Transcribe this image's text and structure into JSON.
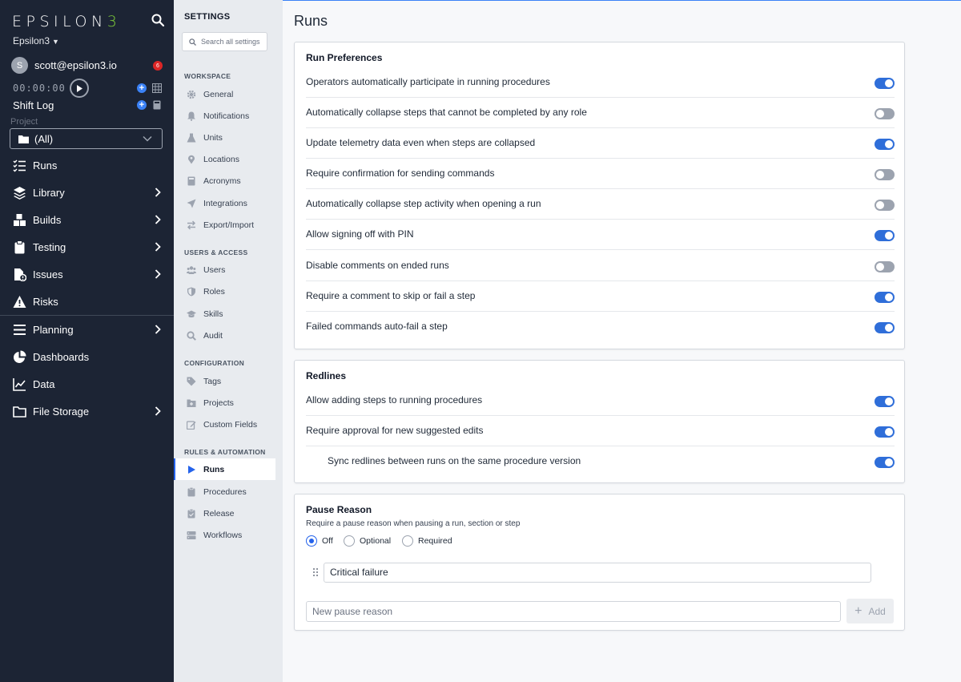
{
  "nav": {
    "logo_main": "EPSILON",
    "logo_accent": "3",
    "workspace": "Epsilon3",
    "user_initial": "S",
    "user_email": "scott@epsilon3.io",
    "notification_count": "6",
    "timer": "00:00:00",
    "shift_log": "Shift Log",
    "project_label": "Project",
    "project_value": "(All)",
    "items": [
      {
        "label": "Runs",
        "icon": "list-check-icon"
      },
      {
        "label": "Library",
        "icon": "layers-icon"
      },
      {
        "label": "Builds",
        "icon": "cubes-icon"
      },
      {
        "label": "Testing",
        "icon": "clipboard-icon"
      },
      {
        "label": "Issues",
        "icon": "file-alert-icon"
      },
      {
        "label": "Risks",
        "icon": "warning-icon"
      },
      {
        "label": "Planning",
        "icon": "bars-icon"
      },
      {
        "label": "Dashboards",
        "icon": "pie-chart-icon"
      },
      {
        "label": "Data",
        "icon": "line-chart-icon"
      },
      {
        "label": "File Storage",
        "icon": "folder-icon"
      }
    ]
  },
  "settings": {
    "title": "SETTINGS",
    "search_placeholder": "Search all settings",
    "groups": {
      "workspace": "WORKSPACE",
      "users": "USERS & ACCESS",
      "config": "CONFIGURATION",
      "rules": "RULES & AUTOMATION"
    },
    "items": {
      "general": "General",
      "notifications": "Notifications",
      "units": "Units",
      "locations": "Locations",
      "acronyms": "Acronyms",
      "integrations": "Integrations",
      "export_import": "Export/Import",
      "users": "Users",
      "roles": "Roles",
      "skills": "Skills",
      "audit": "Audit",
      "tags": "Tags",
      "projects": "Projects",
      "custom_fields": "Custom Fields",
      "runs": "Runs",
      "procedures": "Procedures",
      "release": "Release",
      "workflows": "Workflows"
    }
  },
  "main": {
    "title": "Runs",
    "run_preferences": {
      "title": "Run Preferences",
      "rows": [
        {
          "label": "Operators automatically participate in running procedures",
          "on": true
        },
        {
          "label": "Automatically collapse steps that cannot be completed by any role",
          "on": false
        },
        {
          "label": "Update telemetry data even when steps are collapsed",
          "on": true
        },
        {
          "label": "Require confirmation for sending commands",
          "on": false
        },
        {
          "label": "Automatically collapse step activity when opening a run",
          "on": false
        },
        {
          "label": "Allow signing off with PIN",
          "on": true
        },
        {
          "label": "Disable comments on ended runs",
          "on": false
        },
        {
          "label": "Require a comment to skip or fail a step",
          "on": true
        },
        {
          "label": "Failed commands auto-fail a step",
          "on": true
        }
      ]
    },
    "redlines": {
      "title": "Redlines",
      "rows": [
        {
          "label": "Allow adding steps to running procedures",
          "on": true
        },
        {
          "label": "Require approval for new suggested edits",
          "on": true
        },
        {
          "label": "Sync redlines between runs on the same procedure version",
          "on": true
        }
      ]
    },
    "pause_reason": {
      "title": "Pause Reason",
      "description": "Require a pause reason when pausing a run, section or step",
      "options": [
        "Off",
        "Optional",
        "Required"
      ],
      "selected": "Off",
      "reasons": [
        "Critical failure"
      ],
      "new_placeholder": "New pause reason",
      "add_label": "Add"
    }
  },
  "colors": {
    "sidebar": "#1c2434",
    "accent": "#2f6ed9",
    "logo_accent": "#7fcf3a",
    "badge": "#dc2626"
  }
}
